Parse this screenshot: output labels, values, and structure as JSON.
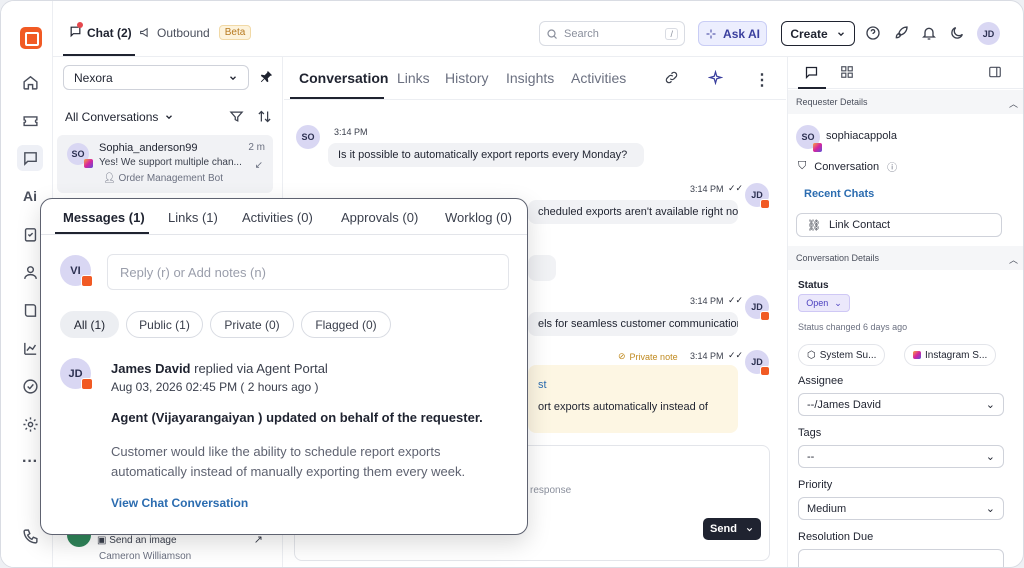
{
  "topbar": {
    "chat_tab": "Chat (2)",
    "outbound_tab": "Outbound",
    "beta_badge": "Beta",
    "search_placeholder": "Search",
    "search_shortcut": "/",
    "ask_ai": "Ask AI",
    "create": "Create",
    "user_initials": "JD"
  },
  "list": {
    "workspace": "Nexora",
    "filter_label": "All Conversations",
    "items": [
      {
        "initials": "SO",
        "name": "Sophia_anderson99",
        "time": "2 m",
        "preview": "Yes! We support multiple chan...",
        "assignee": "Order Management Bot"
      },
      {
        "preview": "Send an image",
        "name": "Cameron Williamson"
      }
    ]
  },
  "main": {
    "tabs": [
      "Conversation",
      "Links",
      "History",
      "Insights",
      "Activities"
    ],
    "messages": [
      {
        "initials": "SO",
        "time": "3:14 PM",
        "text": "Is it possible to automatically export reports every Monday?"
      },
      {
        "initials": "JD",
        "time": "3:14 PM",
        "text": "cheduled exports aren't available right now."
      },
      {
        "initials": "JD",
        "time": "3:14 PM",
        "text": "els for seamless customer communication."
      },
      {
        "initials": "JD",
        "time": "3:14 PM",
        "note_label": "Private note",
        "text_a": "st",
        "text_b": "ort exports automatically instead of"
      }
    ],
    "composer_hint": "response",
    "send": "Send"
  },
  "right": {
    "requester_section": "Requester Details",
    "requester_initials": "SO",
    "requester_name": "sophiacappola",
    "conversation_label": "Conversation",
    "recent_chats": "Recent Chats",
    "link_contact": "Link Contact",
    "conv_section": "Conversation Details",
    "status_label": "Status",
    "status_value": "Open",
    "status_changed": "Status changed 6 days ago",
    "chip_system": "System Su...",
    "chip_instagram": "Instagram S...",
    "assignee_label": "Assignee",
    "assignee_value": "--/James David",
    "tags_label": "Tags",
    "tags_value": "--",
    "priority_label": "Priority",
    "priority_value": "Medium",
    "resolution_label": "Resolution Due"
  },
  "popup": {
    "tabs": [
      "Messages (1)",
      "Links (1)",
      "Activities (0)",
      "Approvals (0)",
      "Worklog (0)"
    ],
    "self_initials": "VI",
    "reply_placeholder": "Reply (r) or Add notes (n)",
    "filters": [
      "All (1)",
      "Public (1)",
      "Private (0)",
      "Flagged (0)"
    ],
    "entry": {
      "initials": "JD",
      "author": "James David",
      "via": " replied via Agent Portal",
      "time": "Aug 03, 2026 02:45 PM ( 2 hours ago )",
      "title": "Agent (Vijayarangaiyan ) updated on behalf of the requester.",
      "body": "Customer would like the ability to schedule report exports automatically instead of manually exporting them every week.",
      "link": "View Chat Conversation"
    }
  },
  "colors": {
    "brand": "#f15a24",
    "accent": "#4a3fbf",
    "link": "#2b6cb0"
  }
}
